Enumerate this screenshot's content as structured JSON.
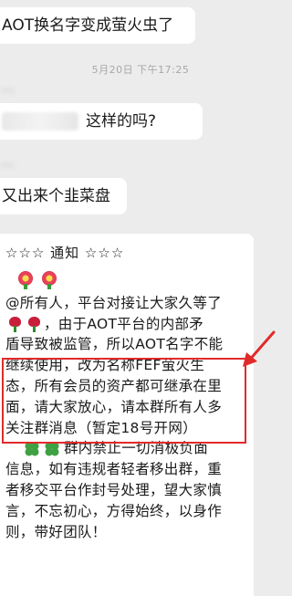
{
  "messages": [
    {
      "text": "AOT换名字变成萤火虫了"
    },
    {
      "text": "这样的吗?"
    },
    {
      "text": "又出来个韭菜盘"
    }
  ],
  "timestamp": "5月20日 下午17:25",
  "notice": {
    "stars_left": "☆☆☆",
    "title": "通知",
    "stars_right": "☆☆☆",
    "lines": [
      "@所有人，平台对接让大家久等了",
      "，由于AOT平台的内部矛",
      "盾导致被监管，所以AOT名字不能",
      "继续使用，改为名称FEF萤火生",
      "态，所有会员的资产都可继承在里",
      "面，请大家放心，请本群所有人多",
      "关注群消息（暂定18号开网）",
      "群内禁止一切消极负面",
      "信息，如有违规者轻者移出群，重",
      "者移交平台作封号处理，望大家慎",
      "言，不忘初心，方得始终，以身作",
      "则，带好团队！"
    ]
  },
  "colors": {
    "highlight_border": "#e12a2a",
    "arrow": "#e12a2a",
    "bubble_bg": "#ffffff",
    "chat_bg": "#ececec"
  }
}
